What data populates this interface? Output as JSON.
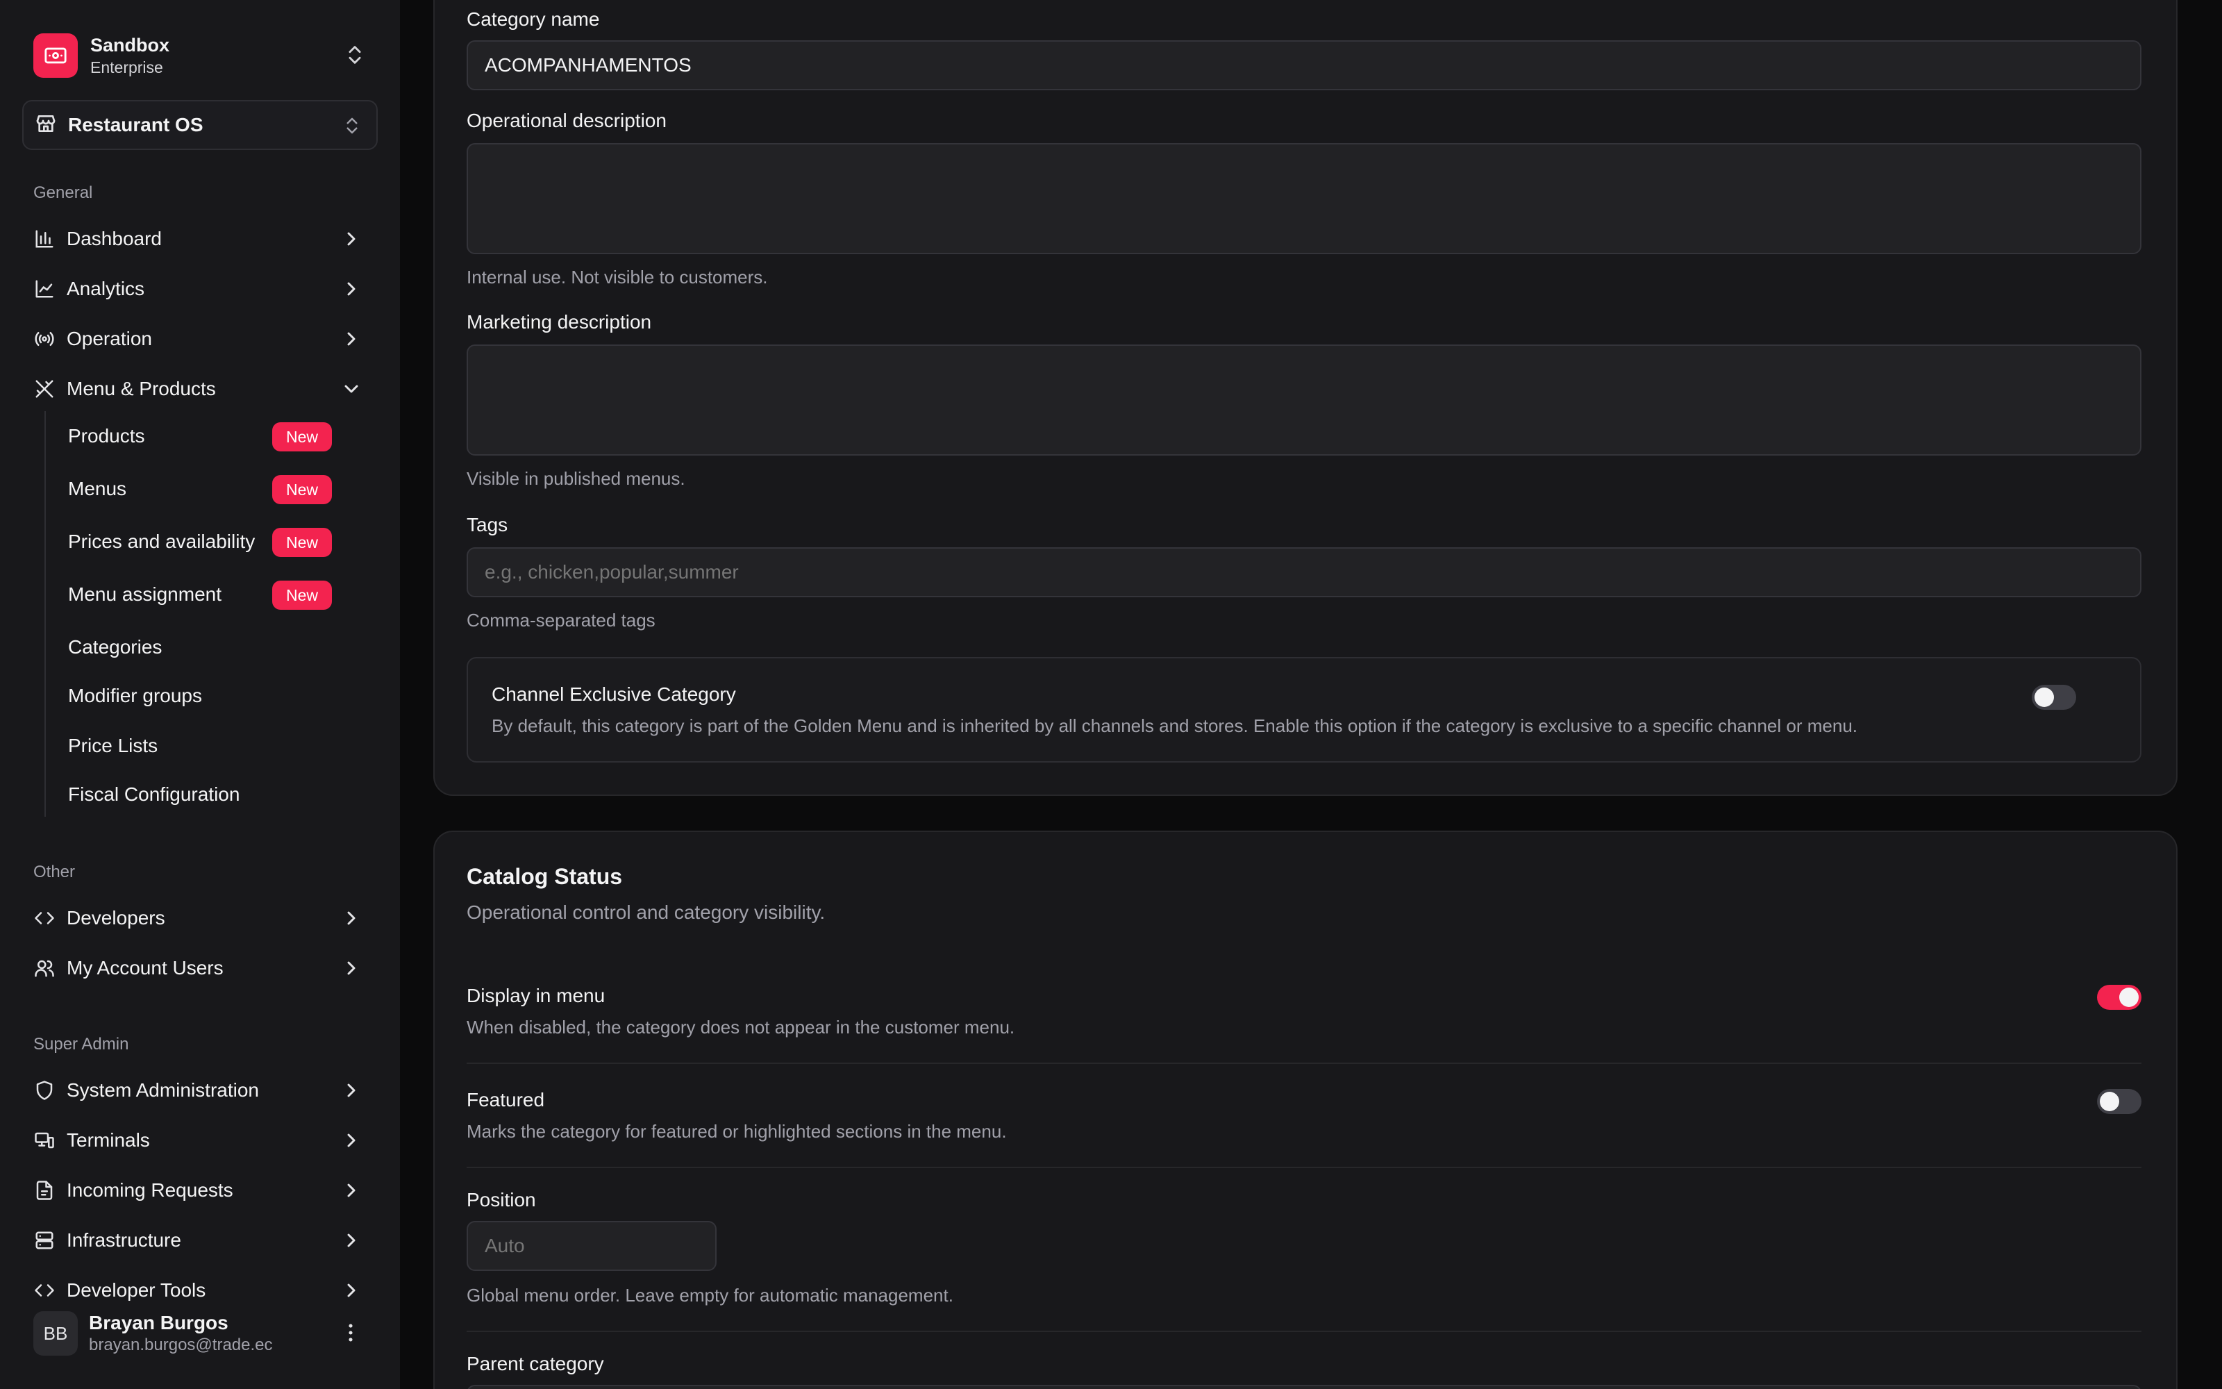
{
  "colors": {
    "accent": "#f3234f",
    "background": "#0b0b0c",
    "sidebar": "#18181b",
    "card": "#18181b"
  },
  "team": {
    "name": "Sandbox",
    "plan": "Enterprise",
    "logo_icon": "ticket-icon"
  },
  "store": {
    "name": "Restaurant OS",
    "icon": "store-icon"
  },
  "sidebar": {
    "general_label": "General",
    "general": [
      {
        "label": "Dashboard",
        "icon": "bar-chart-icon"
      },
      {
        "label": "Analytics",
        "icon": "line-chart-icon"
      },
      {
        "label": "Operation",
        "icon": "radio-icon"
      },
      {
        "label": "Menu & Products",
        "icon": "utensils-icon",
        "expanded": true
      }
    ],
    "menu_sub": [
      {
        "label": "Products",
        "badge": "New"
      },
      {
        "label": "Menus",
        "badge": "New"
      },
      {
        "label": "Prices and availability",
        "badge": "New"
      },
      {
        "label": "Menu assignment",
        "badge": "New"
      },
      {
        "label": "Categories"
      },
      {
        "label": "Modifier groups"
      },
      {
        "label": "Price Lists"
      },
      {
        "label": "Fiscal Configuration"
      }
    ],
    "other_label": "Other",
    "other": [
      {
        "label": "Developers",
        "icon": "code-icon"
      },
      {
        "label": "My Account Users",
        "icon": "users-icon"
      }
    ],
    "super_label": "Super Admin",
    "super": [
      {
        "label": "System Administration",
        "icon": "shield-icon"
      },
      {
        "label": "Terminals",
        "icon": "monitor-icon"
      },
      {
        "label": "Incoming Requests",
        "icon": "file-icon"
      },
      {
        "label": "Infrastructure",
        "icon": "server-icon"
      },
      {
        "label": "Developer Tools",
        "icon": "code-icon"
      }
    ]
  },
  "user": {
    "initials": "BB",
    "name": "Brayan Burgos",
    "email": "brayan.burgos@trade.ec"
  },
  "form": {
    "category_name_label": "Category name",
    "category_name_value": "ACOMPANHAMENTOS",
    "op_desc_label": "Operational description",
    "op_desc_value": "",
    "op_desc_help": "Internal use. Not visible to customers.",
    "mk_desc_label": "Marketing description",
    "mk_desc_value": "",
    "mk_desc_help": "Visible in published menus.",
    "tags_label": "Tags",
    "tags_placeholder": "e.g., chicken,popular,summer",
    "tags_help": "Comma-separated tags",
    "exclusive_title": "Channel Exclusive Category",
    "exclusive_desc": "By default, this category is part of the Golden Menu and is inherited by all channels and stores. Enable this option if the category is exclusive to a specific channel or menu.",
    "exclusive_enabled": false
  },
  "catalog": {
    "title": "Catalog Status",
    "subtitle": "Operational control and category visibility.",
    "display_title": "Display in menu",
    "display_desc": "When disabled, the category does not appear in the customer menu.",
    "display_enabled": true,
    "featured_title": "Featured",
    "featured_desc": "Marks the category for featured or highlighted sections in the menu.",
    "featured_enabled": false,
    "position_label": "Position",
    "position_placeholder": "Auto",
    "position_help": "Global menu order. Leave empty for automatic management.",
    "parent_label": "Parent category"
  }
}
